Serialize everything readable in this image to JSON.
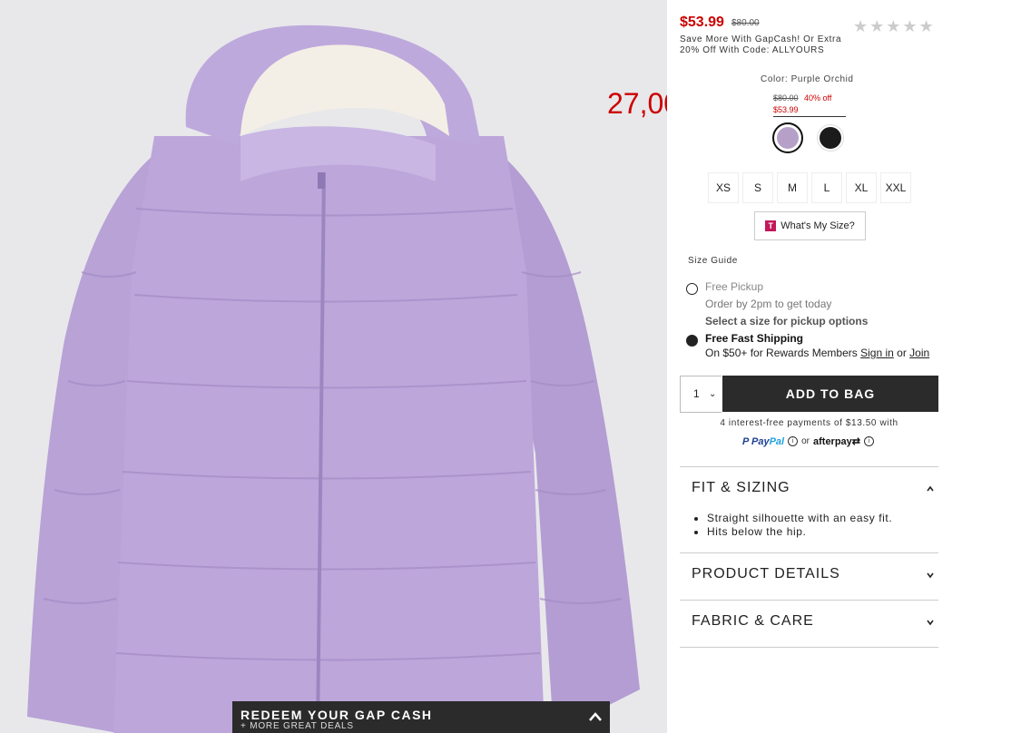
{
  "overlay": {
    "price_text": "27,00"
  },
  "redeem": {
    "title": "REDEEM YOUR GAP CASH",
    "subtitle": "+ MORE GREAT DEALS"
  },
  "product": {
    "price": "$53.99",
    "original_price": "$80.00",
    "rating_stars": "★★★★★",
    "promo_line1": "Save More With GapCash! Or Extra",
    "promo_line2": "20% Off With Code: ALLYOURS",
    "color_label": "Color: Purple Orchid",
    "swatch_original": "$80.00",
    "swatch_discount": "40% off",
    "swatch_sale": "$53.99",
    "swatches": [
      {
        "name": "Purple Orchid",
        "color": "#b7a0c8",
        "selected": true
      },
      {
        "name": "Black",
        "color": "#1b1b1b",
        "selected": false
      }
    ]
  },
  "sizes": [
    "XS",
    "S",
    "M",
    "L",
    "XL",
    "XXL"
  ],
  "whats_my_size": {
    "logo": "T",
    "label": "What's My Size?"
  },
  "size_guide": "Size Guide",
  "fulfillment": {
    "pickup_title": "Free Pickup",
    "pickup_sub": "Order by 2pm to get today",
    "pickup_select": "Select a size for pickup options",
    "shipping_title": "Free Fast Shipping",
    "shipping_sub": "On $50+ for Rewards Members",
    "sign_in": "Sign in",
    "or": "or",
    "join": "Join"
  },
  "cart": {
    "quantity": "1",
    "add_to_bag": "ADD TO BAG",
    "installments": "4 interest-free payments of $13.50 with",
    "paypal_a": "Pay",
    "paypal_b": "Pal",
    "or_text": "or",
    "afterpay": "afterpay"
  },
  "accordion": {
    "fit_title": "FIT & SIZING",
    "fit_bullets": [
      "Straight silhouette with an easy fit.",
      "Hits below the hip."
    ],
    "details_title": "PRODUCT DETAILS",
    "fabric_title": "FABRIC & CARE"
  }
}
